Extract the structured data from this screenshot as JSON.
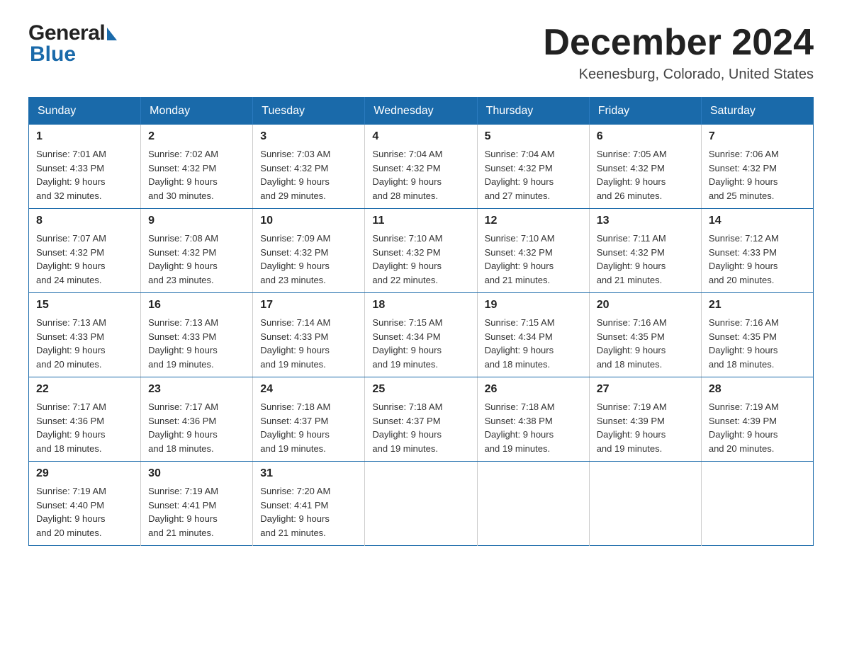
{
  "header": {
    "logo_general": "General",
    "logo_blue": "Blue",
    "month_title": "December 2024",
    "location": "Keenesburg, Colorado, United States"
  },
  "weekdays": [
    "Sunday",
    "Monday",
    "Tuesday",
    "Wednesday",
    "Thursday",
    "Friday",
    "Saturday"
  ],
  "weeks": [
    [
      {
        "day": "1",
        "sunrise": "Sunrise: 7:01 AM",
        "sunset": "Sunset: 4:33 PM",
        "daylight": "Daylight: 9 hours",
        "daylight2": "and 32 minutes."
      },
      {
        "day": "2",
        "sunrise": "Sunrise: 7:02 AM",
        "sunset": "Sunset: 4:32 PM",
        "daylight": "Daylight: 9 hours",
        "daylight2": "and 30 minutes."
      },
      {
        "day": "3",
        "sunrise": "Sunrise: 7:03 AM",
        "sunset": "Sunset: 4:32 PM",
        "daylight": "Daylight: 9 hours",
        "daylight2": "and 29 minutes."
      },
      {
        "day": "4",
        "sunrise": "Sunrise: 7:04 AM",
        "sunset": "Sunset: 4:32 PM",
        "daylight": "Daylight: 9 hours",
        "daylight2": "and 28 minutes."
      },
      {
        "day": "5",
        "sunrise": "Sunrise: 7:04 AM",
        "sunset": "Sunset: 4:32 PM",
        "daylight": "Daylight: 9 hours",
        "daylight2": "and 27 minutes."
      },
      {
        "day": "6",
        "sunrise": "Sunrise: 7:05 AM",
        "sunset": "Sunset: 4:32 PM",
        "daylight": "Daylight: 9 hours",
        "daylight2": "and 26 minutes."
      },
      {
        "day": "7",
        "sunrise": "Sunrise: 7:06 AM",
        "sunset": "Sunset: 4:32 PM",
        "daylight": "Daylight: 9 hours",
        "daylight2": "and 25 minutes."
      }
    ],
    [
      {
        "day": "8",
        "sunrise": "Sunrise: 7:07 AM",
        "sunset": "Sunset: 4:32 PM",
        "daylight": "Daylight: 9 hours",
        "daylight2": "and 24 minutes."
      },
      {
        "day": "9",
        "sunrise": "Sunrise: 7:08 AM",
        "sunset": "Sunset: 4:32 PM",
        "daylight": "Daylight: 9 hours",
        "daylight2": "and 23 minutes."
      },
      {
        "day": "10",
        "sunrise": "Sunrise: 7:09 AM",
        "sunset": "Sunset: 4:32 PM",
        "daylight": "Daylight: 9 hours",
        "daylight2": "and 23 minutes."
      },
      {
        "day": "11",
        "sunrise": "Sunrise: 7:10 AM",
        "sunset": "Sunset: 4:32 PM",
        "daylight": "Daylight: 9 hours",
        "daylight2": "and 22 minutes."
      },
      {
        "day": "12",
        "sunrise": "Sunrise: 7:10 AM",
        "sunset": "Sunset: 4:32 PM",
        "daylight": "Daylight: 9 hours",
        "daylight2": "and 21 minutes."
      },
      {
        "day": "13",
        "sunrise": "Sunrise: 7:11 AM",
        "sunset": "Sunset: 4:32 PM",
        "daylight": "Daylight: 9 hours",
        "daylight2": "and 21 minutes."
      },
      {
        "day": "14",
        "sunrise": "Sunrise: 7:12 AM",
        "sunset": "Sunset: 4:33 PM",
        "daylight": "Daylight: 9 hours",
        "daylight2": "and 20 minutes."
      }
    ],
    [
      {
        "day": "15",
        "sunrise": "Sunrise: 7:13 AM",
        "sunset": "Sunset: 4:33 PM",
        "daylight": "Daylight: 9 hours",
        "daylight2": "and 20 minutes."
      },
      {
        "day": "16",
        "sunrise": "Sunrise: 7:13 AM",
        "sunset": "Sunset: 4:33 PM",
        "daylight": "Daylight: 9 hours",
        "daylight2": "and 19 minutes."
      },
      {
        "day": "17",
        "sunrise": "Sunrise: 7:14 AM",
        "sunset": "Sunset: 4:33 PM",
        "daylight": "Daylight: 9 hours",
        "daylight2": "and 19 minutes."
      },
      {
        "day": "18",
        "sunrise": "Sunrise: 7:15 AM",
        "sunset": "Sunset: 4:34 PM",
        "daylight": "Daylight: 9 hours",
        "daylight2": "and 19 minutes."
      },
      {
        "day": "19",
        "sunrise": "Sunrise: 7:15 AM",
        "sunset": "Sunset: 4:34 PM",
        "daylight": "Daylight: 9 hours",
        "daylight2": "and 18 minutes."
      },
      {
        "day": "20",
        "sunrise": "Sunrise: 7:16 AM",
        "sunset": "Sunset: 4:35 PM",
        "daylight": "Daylight: 9 hours",
        "daylight2": "and 18 minutes."
      },
      {
        "day": "21",
        "sunrise": "Sunrise: 7:16 AM",
        "sunset": "Sunset: 4:35 PM",
        "daylight": "Daylight: 9 hours",
        "daylight2": "and 18 minutes."
      }
    ],
    [
      {
        "day": "22",
        "sunrise": "Sunrise: 7:17 AM",
        "sunset": "Sunset: 4:36 PM",
        "daylight": "Daylight: 9 hours",
        "daylight2": "and 18 minutes."
      },
      {
        "day": "23",
        "sunrise": "Sunrise: 7:17 AM",
        "sunset": "Sunset: 4:36 PM",
        "daylight": "Daylight: 9 hours",
        "daylight2": "and 18 minutes."
      },
      {
        "day": "24",
        "sunrise": "Sunrise: 7:18 AM",
        "sunset": "Sunset: 4:37 PM",
        "daylight": "Daylight: 9 hours",
        "daylight2": "and 19 minutes."
      },
      {
        "day": "25",
        "sunrise": "Sunrise: 7:18 AM",
        "sunset": "Sunset: 4:37 PM",
        "daylight": "Daylight: 9 hours",
        "daylight2": "and 19 minutes."
      },
      {
        "day": "26",
        "sunrise": "Sunrise: 7:18 AM",
        "sunset": "Sunset: 4:38 PM",
        "daylight": "Daylight: 9 hours",
        "daylight2": "and 19 minutes."
      },
      {
        "day": "27",
        "sunrise": "Sunrise: 7:19 AM",
        "sunset": "Sunset: 4:39 PM",
        "daylight": "Daylight: 9 hours",
        "daylight2": "and 19 minutes."
      },
      {
        "day": "28",
        "sunrise": "Sunrise: 7:19 AM",
        "sunset": "Sunset: 4:39 PM",
        "daylight": "Daylight: 9 hours",
        "daylight2": "and 20 minutes."
      }
    ],
    [
      {
        "day": "29",
        "sunrise": "Sunrise: 7:19 AM",
        "sunset": "Sunset: 4:40 PM",
        "daylight": "Daylight: 9 hours",
        "daylight2": "and 20 minutes."
      },
      {
        "day": "30",
        "sunrise": "Sunrise: 7:19 AM",
        "sunset": "Sunset: 4:41 PM",
        "daylight": "Daylight: 9 hours",
        "daylight2": "and 21 minutes."
      },
      {
        "day": "31",
        "sunrise": "Sunrise: 7:20 AM",
        "sunset": "Sunset: 4:41 PM",
        "daylight": "Daylight: 9 hours",
        "daylight2": "and 21 minutes."
      },
      {
        "day": "",
        "sunrise": "",
        "sunset": "",
        "daylight": "",
        "daylight2": ""
      },
      {
        "day": "",
        "sunrise": "",
        "sunset": "",
        "daylight": "",
        "daylight2": ""
      },
      {
        "day": "",
        "sunrise": "",
        "sunset": "",
        "daylight": "",
        "daylight2": ""
      },
      {
        "day": "",
        "sunrise": "",
        "sunset": "",
        "daylight": "",
        "daylight2": ""
      }
    ]
  ]
}
